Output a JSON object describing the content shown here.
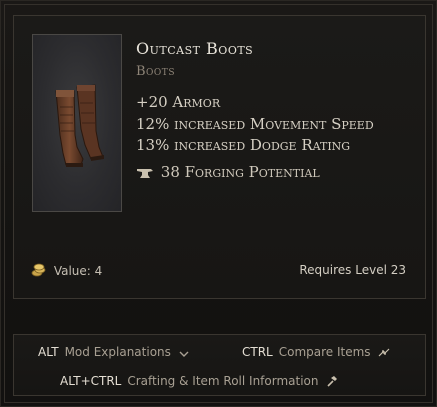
{
  "item": {
    "name": "Outcast Boots",
    "type": "Boots",
    "stats": [
      "+20 Armor",
      "12% increased Movement Speed",
      "13% increased Dodge Rating"
    ],
    "forging_potential": "38 Forging Potential"
  },
  "footer": {
    "value_text": "Value: 4",
    "requirement": "Requires Level 23"
  },
  "hints": {
    "mod_key": "ALT",
    "mod_label": "Mod Explanations",
    "compare_key": "CTRL",
    "compare_label": "Compare Items",
    "craft_key": "ALT+CTRL",
    "craft_label": "Crafting & Item Roll Information"
  },
  "icons": {
    "item": "leather-boots-icon",
    "forge": "anvil-icon",
    "value": "gold-coin-icon",
    "mod": "chevron-down-icon",
    "compare": "compare-arrows-icon",
    "craft": "hammer-icon"
  },
  "colors": {
    "name": "#e8e4da",
    "type": "#8f8578",
    "stat": "#d6d0c4",
    "background": "#141311"
  }
}
